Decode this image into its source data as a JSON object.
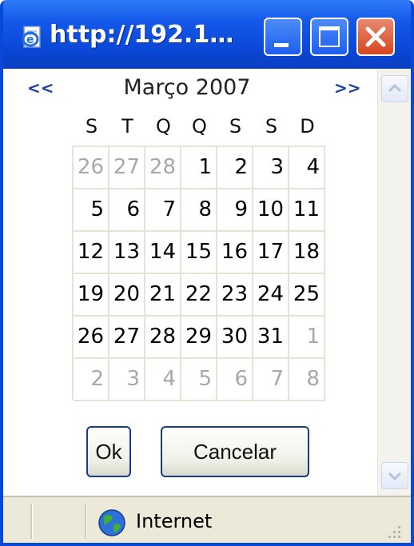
{
  "window": {
    "title": "http://192.1…"
  },
  "calendar": {
    "prev_label": "<<",
    "next_label": ">>",
    "month_label": "Março 2007",
    "weekdays": [
      "S",
      "T",
      "Q",
      "Q",
      "S",
      "S",
      "D"
    ],
    "weeks": [
      [
        {
          "d": "26",
          "other": true
        },
        {
          "d": "27",
          "other": true
        },
        {
          "d": "28",
          "other": true
        },
        {
          "d": "1"
        },
        {
          "d": "2"
        },
        {
          "d": "3"
        },
        {
          "d": "4"
        }
      ],
      [
        {
          "d": "5"
        },
        {
          "d": "6"
        },
        {
          "d": "7"
        },
        {
          "d": "8"
        },
        {
          "d": "9"
        },
        {
          "d": "10"
        },
        {
          "d": "11"
        }
      ],
      [
        {
          "d": "12"
        },
        {
          "d": "13"
        },
        {
          "d": "14"
        },
        {
          "d": "15"
        },
        {
          "d": "16"
        },
        {
          "d": "17"
        },
        {
          "d": "18"
        }
      ],
      [
        {
          "d": "19"
        },
        {
          "d": "20"
        },
        {
          "d": "21"
        },
        {
          "d": "22"
        },
        {
          "d": "23"
        },
        {
          "d": "24"
        },
        {
          "d": "25"
        }
      ],
      [
        {
          "d": "26"
        },
        {
          "d": "27"
        },
        {
          "d": "28"
        },
        {
          "d": "29"
        },
        {
          "d": "30"
        },
        {
          "d": "31"
        },
        {
          "d": "1",
          "other": true
        }
      ],
      [
        {
          "d": "2",
          "other": true
        },
        {
          "d": "3",
          "other": true
        },
        {
          "d": "4",
          "other": true
        },
        {
          "d": "5",
          "other": true
        },
        {
          "d": "6",
          "other": true
        },
        {
          "d": "7",
          "other": true
        },
        {
          "d": "8",
          "other": true
        }
      ]
    ]
  },
  "buttons": {
    "ok": "Ok",
    "cancel": "Cancelar"
  },
  "statusbar": {
    "zone": "Internet"
  },
  "icons": {
    "title": "ie-page-icon",
    "zone": "earth-icon",
    "grip": "resize-grip-icon"
  },
  "colors": {
    "titlebar": "#0a48d8",
    "close": "#d6461f",
    "other_month": "#a8a8a8",
    "grid": "#e6e2d6",
    "nav": "#1a3fa6"
  }
}
